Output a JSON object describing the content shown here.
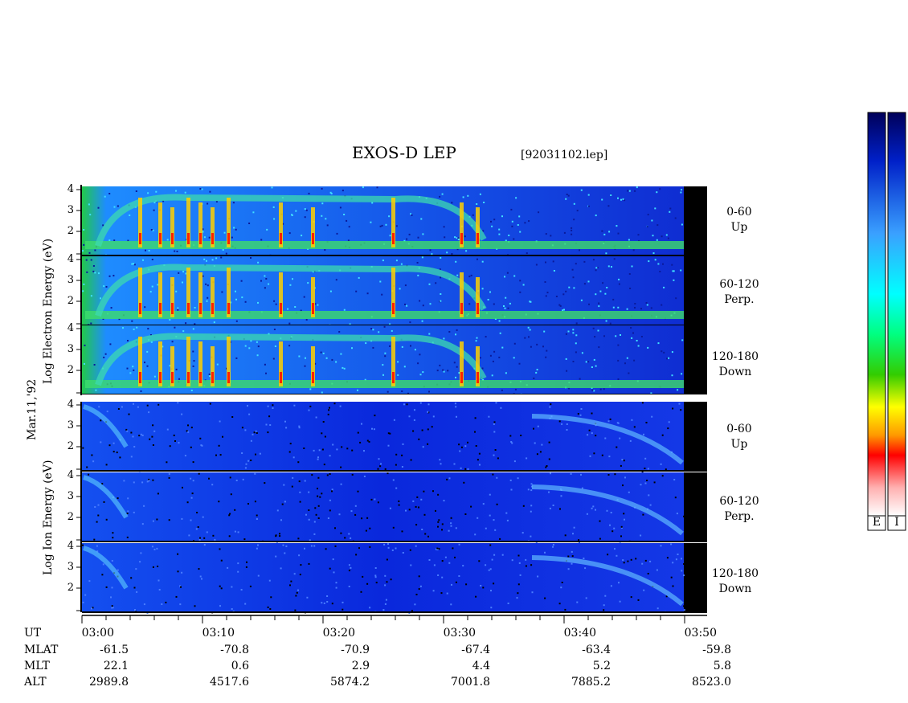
{
  "title": "EXOS-D LEP",
  "file": "[92031102.lep]",
  "date_label": "Mar.11,'92",
  "y_axis": {
    "electron": "Log   Electron   Energy  (eV)",
    "ion": "Log   Ion   Energy  (eV)"
  },
  "panel_labels": [
    {
      "range": "0-60",
      "dir": "Up"
    },
    {
      "range": "60-120",
      "dir": "Perp."
    },
    {
      "range": "120-180",
      "dir": "Down"
    },
    {
      "range": "0-60",
      "dir": "Up"
    },
    {
      "range": "60-120",
      "dir": "Perp."
    },
    {
      "range": "120-180",
      "dir": "Down"
    }
  ],
  "colorbar_labels": [
    "E",
    "I"
  ],
  "table": {
    "rows": [
      {
        "label": "UT",
        "values": [
          "03:00",
          "03:10",
          "03:20",
          "03:30",
          "03:40",
          "03:50"
        ]
      },
      {
        "label": "MLAT",
        "values": [
          "-61.5",
          "-70.8",
          "-70.9",
          "-67.4",
          "-63.4",
          "-59.8"
        ]
      },
      {
        "label": "MLT",
        "values": [
          "22.1",
          "0.6",
          "2.9",
          "4.4",
          "5.2",
          "5.8"
        ]
      },
      {
        "label": "ALT",
        "values": [
          "2989.8",
          "4517.6",
          "5874.2",
          "7001.8",
          "7885.2",
          "8523.0"
        ]
      }
    ]
  },
  "chart_data": {
    "type": "heatmap",
    "title": "EXOS-D LEP",
    "x": [
      "03:00",
      "03:10",
      "03:20",
      "03:30",
      "03:40",
      "03:50"
    ],
    "ylim": [
      1,
      4
    ],
    "y_ticks": [
      "4",
      "3",
      "2"
    ],
    "colorscale": [
      "#ffffff",
      "#ff0000",
      "#ffa500",
      "#ffff00",
      "#00ff00",
      "#00ffff",
      "#0000ff",
      "#00008b"
    ],
    "panels": [
      {
        "species": "Electron",
        "pitch": "0-60 Up"
      },
      {
        "species": "Electron",
        "pitch": "60-120 Perp."
      },
      {
        "species": "Electron",
        "pitch": "120-180 Down"
      },
      {
        "species": "Ion",
        "pitch": "0-60 Up"
      },
      {
        "species": "Ion",
        "pitch": "60-120 Perp."
      },
      {
        "species": "Ion",
        "pitch": "120-180 Down"
      }
    ]
  }
}
